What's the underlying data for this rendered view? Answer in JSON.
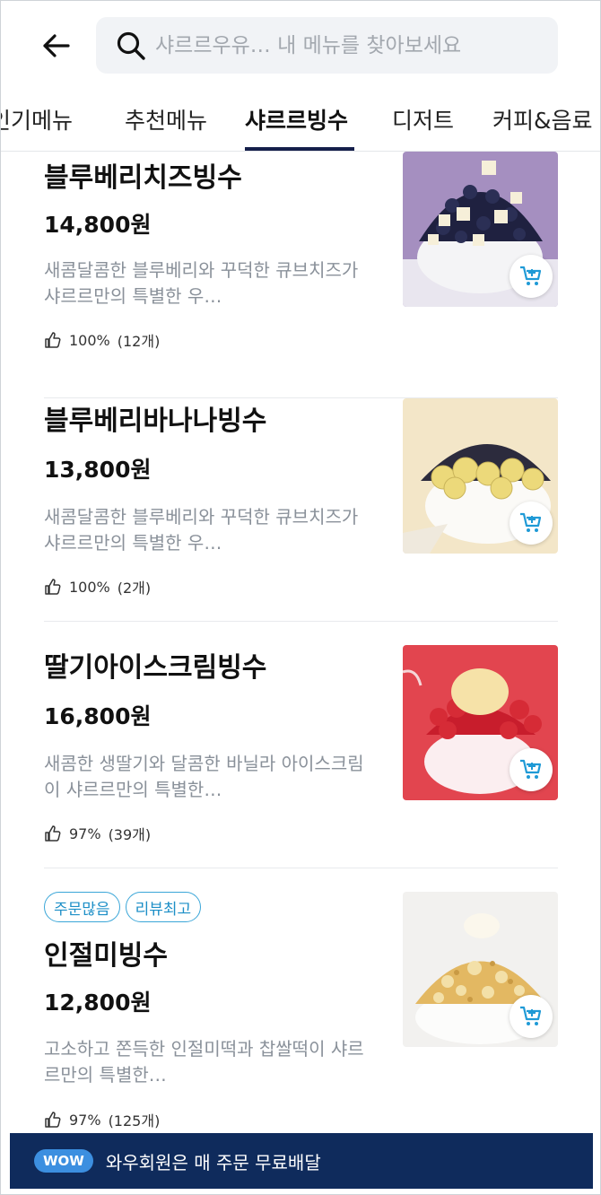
{
  "header": {
    "back_icon": "back-arrow-icon",
    "search_icon": "search-icon",
    "search_placeholder": "샤르르우유… 내 메뉴를 찾아보세요"
  },
  "tabs": [
    {
      "label": "인기메뉴"
    },
    {
      "label": "추천메뉴"
    },
    {
      "label": "샤르르빙수",
      "active": true
    },
    {
      "label": "디저트"
    },
    {
      "label": "커피&음료"
    }
  ],
  "items": [
    {
      "name": "블루베리치즈빙수",
      "price": "14,800원",
      "description": "새콤달콤한 블루베리와 꾸덕한 큐브치즈가 샤르르만의 특별한 우…",
      "rating": "100%",
      "review_count": "(12개)",
      "image": "blueberry-cheese-bingsu"
    },
    {
      "name": "블루베리바나나빙수",
      "price": "13,800원",
      "description": "새콤달콤한 블루베리와 꾸덕한 큐브치즈가 샤르르만의 특별한 우…",
      "rating": "100%",
      "review_count": "(2개)",
      "image": "blueberry-banana-bingsu"
    },
    {
      "name": "딸기아이스크림빙수",
      "price": "16,800원",
      "description": "새콤한 생딸기와 달콤한 바닐라 아이스크림이 샤르르만의 특별한…",
      "rating": "97%",
      "review_count": "(39개)",
      "image": "strawberry-icecream-bingsu"
    },
    {
      "name": "인절미빙수",
      "price": "12,800원",
      "description": "고소하고 쫀득한 인절미떡과 찹쌀떡이 샤르르만의 특별한…",
      "rating": "97%",
      "review_count": "(125개)",
      "badges": [
        "주문많음",
        "리뷰최고"
      ],
      "image": "injeolmi-bingsu"
    }
  ],
  "wow_bar": {
    "badge": "WOW",
    "text": "와우회원은 매 주문 무료배달"
  },
  "colors": {
    "accent_navy": "#151f4a",
    "wow_bar_bg": "#0f2b5c",
    "badge_blue": "#1d8fc7",
    "cart_icon": "#1f9ad6"
  }
}
